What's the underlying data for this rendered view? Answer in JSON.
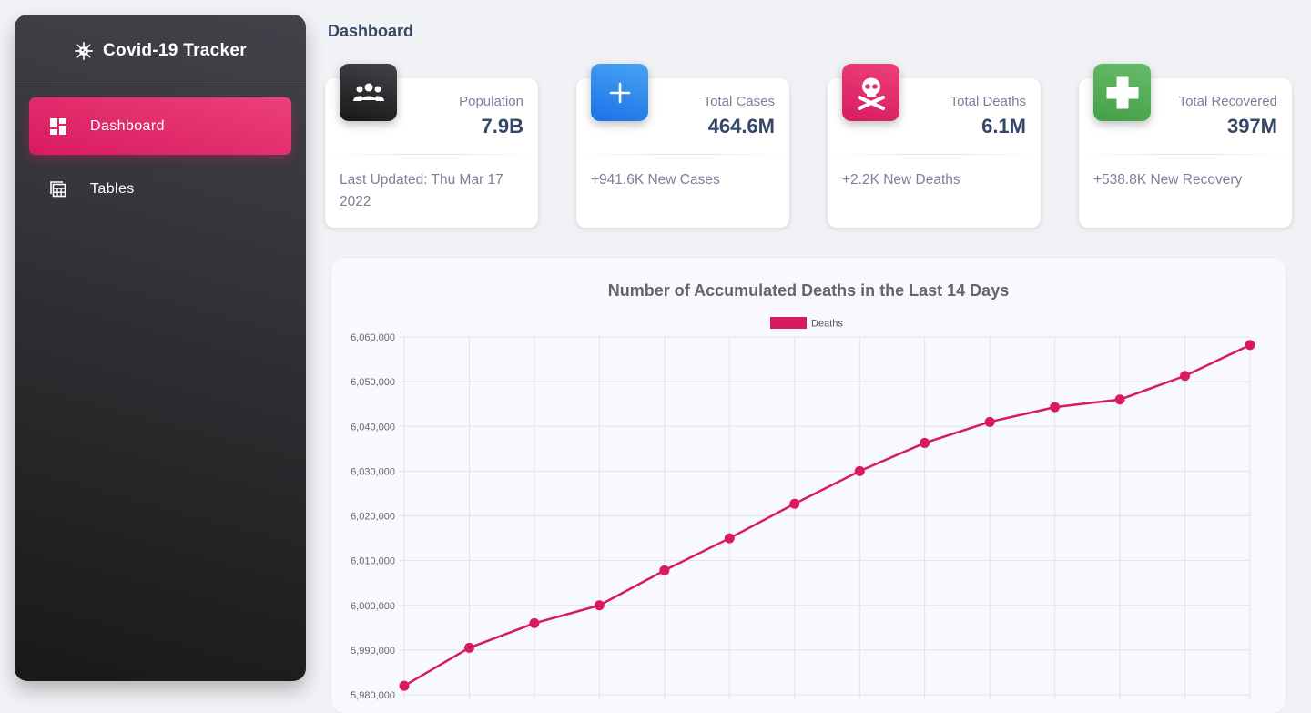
{
  "sidebar": {
    "brand": "Covid-19 Tracker",
    "items": [
      {
        "label": "Dashboard",
        "icon": "dashboard-icon",
        "active": true
      },
      {
        "label": "Tables",
        "icon": "table-icon",
        "active": false
      }
    ]
  },
  "page_title": "Dashboard",
  "cards": [
    {
      "label": "Population",
      "value": "7.9B",
      "footer": "Last Updated: Thu Mar 17 2022",
      "icon": "group-icon",
      "color": "#2d2d33"
    },
    {
      "label": "Total Cases",
      "value": "464.6M",
      "footer": "+941.6K New Cases",
      "icon": "plus-icon",
      "color": "#1a73e8"
    },
    {
      "label": "Total Deaths",
      "value": "6.1M",
      "footer": "+2.2K New Deaths",
      "icon": "skull-crossbones-icon",
      "color": "#e91e63"
    },
    {
      "label": "Total Recovered",
      "value": "397M",
      "footer": "+538.8K New Recovery",
      "icon": "medical-cross-icon",
      "color": "#4caf50"
    }
  ],
  "chart_data": {
    "type": "line",
    "title": "Number of Accumulated Deaths in the Last 14 Days",
    "series": [
      {
        "name": "Deaths",
        "color": "#d81b60",
        "values": [
          5982000,
          5990500,
          5996000,
          6000000,
          6007800,
          6015000,
          6022700,
          6030000,
          6036300,
          6041000,
          6044300,
          6046000,
          6051300,
          6058200
        ]
      }
    ],
    "ylim": [
      5980000,
      6060000
    ],
    "yticks": [
      {
        "value": 6060000,
        "label": "6,060,000"
      },
      {
        "value": 6050000,
        "label": "6,050,000"
      },
      {
        "value": 6040000,
        "label": "6,040,000"
      },
      {
        "value": 6030000,
        "label": "6,030,000"
      },
      {
        "value": 6020000,
        "label": "6,020,000"
      },
      {
        "value": 6010000,
        "label": "6,010,000"
      },
      {
        "value": 6000000,
        "label": "6,000,000"
      },
      {
        "value": 5990000,
        "label": "5,990,000"
      },
      {
        "value": 5980000,
        "label": "5,980,000"
      }
    ],
    "grid": true,
    "legend_position": "top-center"
  }
}
